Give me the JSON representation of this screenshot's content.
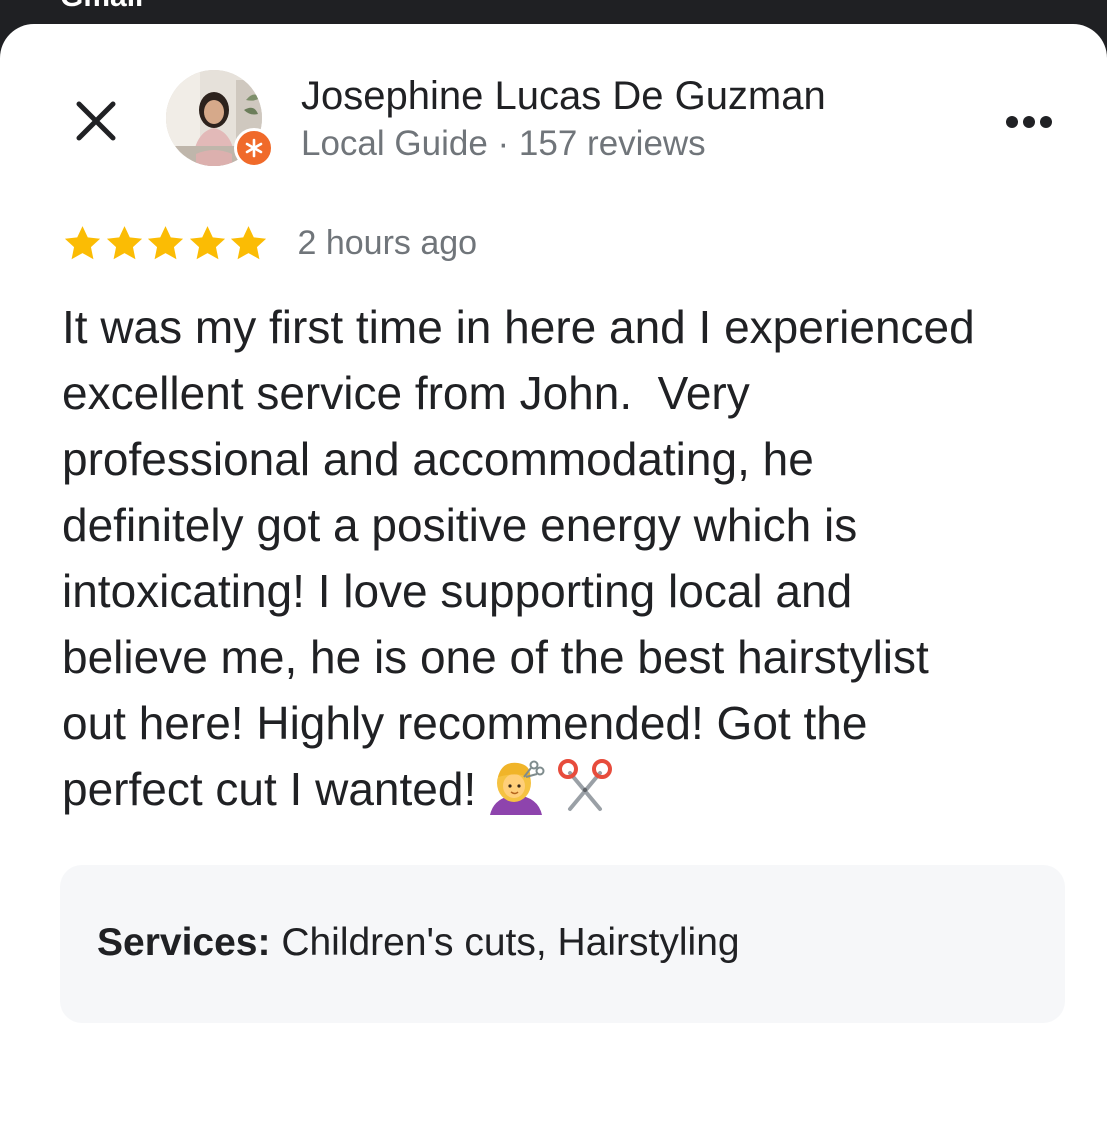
{
  "status_bar": {
    "partial_text": "Gmail"
  },
  "header": {
    "author_name": "Josephine Lucas De Guzman",
    "author_badge": "Local Guide",
    "separator": "·",
    "review_count": "157 reviews",
    "close_icon": "close-icon",
    "more_icon": "more-options-icon",
    "badge_icon": "local-guide-badge-icon"
  },
  "review": {
    "rating": 5,
    "rating_max": 5,
    "time_ago": "2 hours ago",
    "lines": [
      "It was my first time in here and I experienced",
      "excellent service from John.  Very",
      "professional and accommodating, he",
      "definitely got a positive energy which is",
      "intoxicating! I love supporting local and",
      "believe me, he is one of the best hairstylist",
      "out here! Highly recommended! Got the",
      "perfect cut I wanted!"
    ],
    "emojis": [
      "woman-getting-haircut-emoji",
      "scissors-emoji"
    ]
  },
  "services": {
    "label": "Services:",
    "value": "Children's cuts, Hairstyling"
  },
  "colors": {
    "star": "#fbbc04",
    "badge": "#f06a2a",
    "muted_text": "#70757a",
    "primary_text": "#202124",
    "services_bg": "#f6f7f9"
  }
}
